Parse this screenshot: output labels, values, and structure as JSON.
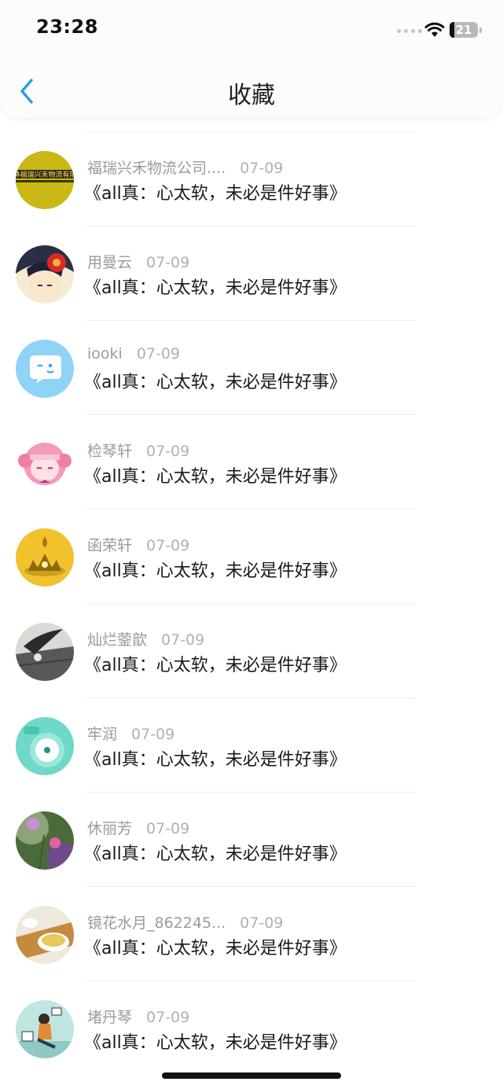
{
  "status_bar": {
    "time": "23:28",
    "battery": "21"
  },
  "header": {
    "title": "收藏"
  },
  "items": [
    {
      "name": "福瑞兴禾物流公司....",
      "date": "07-09",
      "text": "《all真：心太软，未必是件好事》",
      "avatar_label": "林福瑞兴禾物流有限"
    },
    {
      "name": "用曼云",
      "date": "07-09",
      "text": "《all真：心太软，未必是件好事》"
    },
    {
      "name": "iooki",
      "date": "07-09",
      "text": "《all真：心太软，未必是件好事》"
    },
    {
      "name": "检琴轩",
      "date": "07-09",
      "text": "《all真：心太软，未必是件好事》"
    },
    {
      "name": "函荣轩",
      "date": "07-09",
      "text": "《all真：心太软，未必是件好事》"
    },
    {
      "name": "灿烂蓥歆",
      "date": "07-09",
      "text": "《all真：心太软，未必是件好事》"
    },
    {
      "name": "牢润",
      "date": "07-09",
      "text": "《all真：心太软，未必是件好事》"
    },
    {
      "name": "休丽芳",
      "date": "07-09",
      "text": "《all真：心太软，未必是件好事》"
    },
    {
      "name": "镜花水月_862245...",
      "date": "07-09",
      "text": "《all真：心太软，未必是件好事》"
    },
    {
      "name": "堵丹琴",
      "date": "07-09",
      "text": "《all真：心太软，未必是件好事》"
    }
  ],
  "colors": {
    "accent": "#2a9fe0",
    "name_gray": "#9a9a9a",
    "text": "#1a1a1a"
  }
}
